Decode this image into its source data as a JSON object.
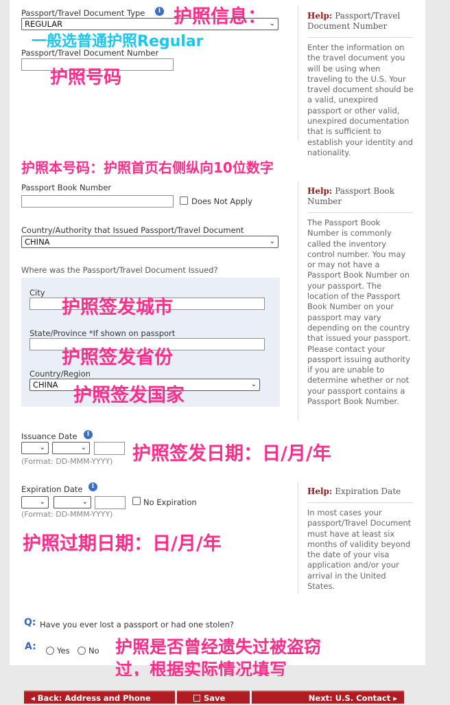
{
  "form": {
    "doc_type_label": "Passport/Travel Document Type",
    "doc_type_value": "REGULAR",
    "doc_number_label": "Passport/Travel Document Number",
    "book_number_label": "Passport Book Number",
    "does_not_apply_label": "Does Not Apply",
    "country_authority_label": "Country/Authority that Issued Passport/Travel Document",
    "country_authority_value": "CHINA",
    "issued_where_label": "Where was the Passport/Travel Document Issued?",
    "city_label": "City",
    "state_label": "State/Province *If shown on passport",
    "country_region_label": "Country/Region",
    "country_region_value": "CHINA",
    "issuance_date_label": "Issuance Date",
    "issuance_format": "(Format: DD-MMM-YYYY)",
    "expiration_date_label": "Expiration Date",
    "no_expiration_label": "No Expiration",
    "expiration_format": "(Format: DD-MMM-YYYY)",
    "question_q": "Q:",
    "question_text": "Have you ever lost a passport or had one stolen?",
    "answer_a": "A:",
    "yes_label": "Yes",
    "no_label": "No"
  },
  "help": {
    "word": "Help:",
    "doc_number_title": "Passport/Travel Document Number",
    "doc_number_body": "Enter the information on the travel document you will be using when traveling to the U.S. Your travel document should be a valid, unexpired passport or other valid, unexpired documentation that is sufficient to establish your identity and nationality.",
    "book_number_title": "Passport Book Number",
    "book_number_body": "The Passport Book Number is commonly called the inventory control number. You may or may not have a Passport Book Number on your passport. The location of the Passport Book Number on your passport may vary depending on the country that issued your passport. Please contact your passport issuing authority if you are unable to determine whether or not your passport contains a Passport Book Number.",
    "expiration_title": "Expiration Date",
    "expiration_body": "In most cases your passport/Travel Document must have at least six months of validity beyond the date of your visa application and/or your arrival in the United States."
  },
  "annotations": {
    "passport_info": "护照信息：",
    "choose_regular": "一般选普通护照Regular",
    "passport_number": "护照号码",
    "book_number": "护照本号码：护照首页右侧纵向10位数字",
    "issue_city": "护照签发城市",
    "issue_province": "护照签发省份",
    "issue_country": "护照签发国家",
    "issue_date": "护照签发日期：日/月/年",
    "expire_date": "护照过期日期：日/月/年",
    "lost_line1": "护照是否曾经遗失过被盗窃",
    "lost_line2": "过，根据实际情况填写"
  },
  "nav": {
    "back_label": "Back: Address and Phone",
    "save_label": "Save",
    "next_label": "Next: U.S. Contact"
  },
  "colors": {
    "annotation_pink": "#ff2e8a",
    "annotation_blue": "#19c7ef",
    "button_red": "#b01c22",
    "help_red": "#8b1a1a",
    "question_blue": "#3a68b8"
  },
  "icons": {
    "info": "info-icon",
    "chevron": "chevron-down-icon",
    "save": "floppy-disk-icon"
  }
}
